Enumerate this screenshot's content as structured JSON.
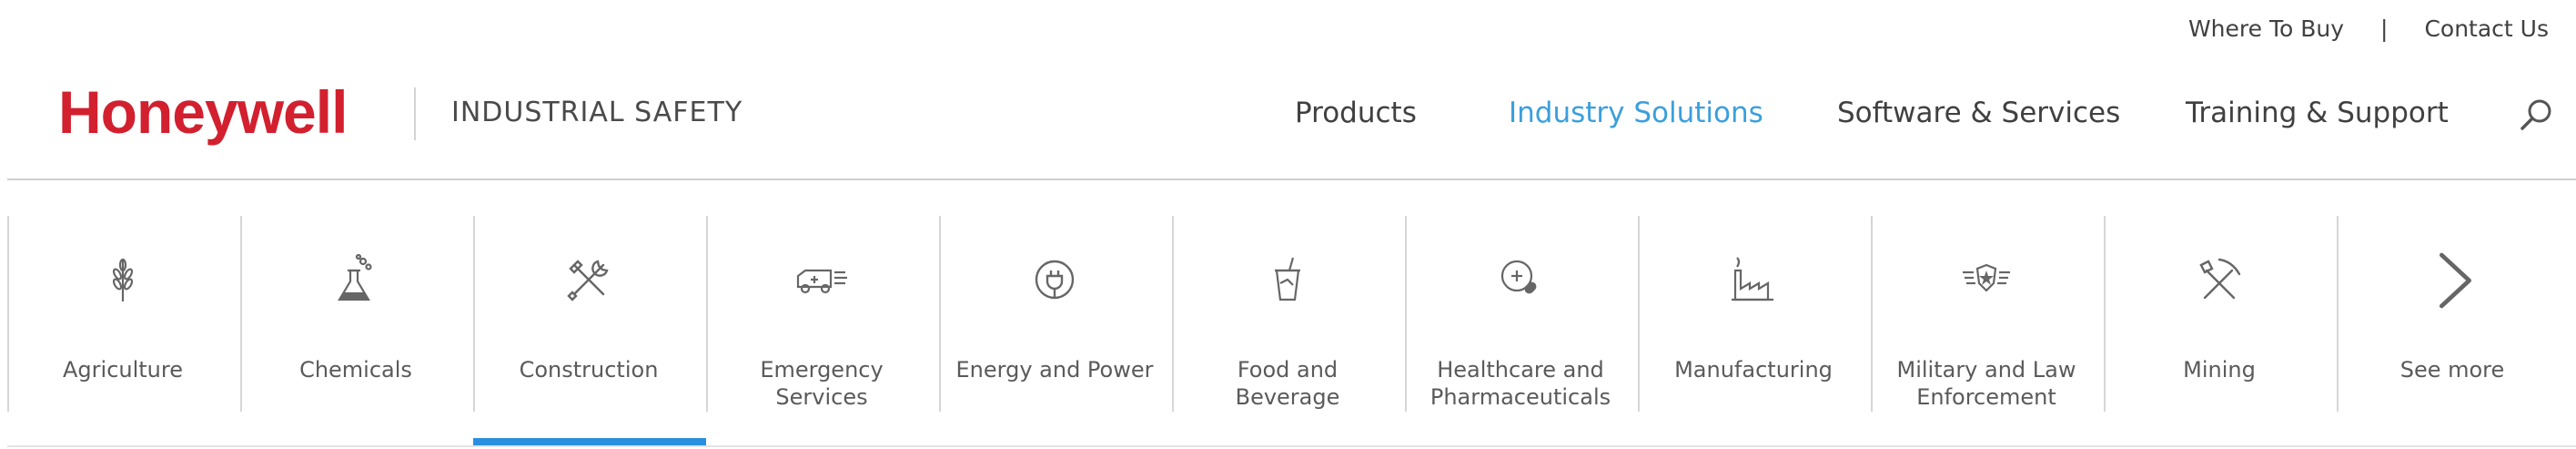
{
  "utility": {
    "where_to_buy": "Where To Buy",
    "separator": "|",
    "contact_us": "Contact Us"
  },
  "brand": {
    "logo_text": "Honeywell",
    "division": "INDUSTRIAL SAFETY",
    "logo_color": "#d2202f"
  },
  "nav": {
    "items": [
      {
        "label": "Products",
        "active": false
      },
      {
        "label": "Industry Solutions",
        "active": true
      },
      {
        "label": "Software & Services",
        "active": false
      },
      {
        "label": "Training & Support",
        "active": false
      }
    ],
    "active_color": "#3a9fdd",
    "search_icon": "search-icon"
  },
  "industries": {
    "selected": "Construction",
    "accent_color": "#2b8fe0",
    "items": [
      {
        "label": "Agriculture",
        "icon": "wheat-icon"
      },
      {
        "label": "Chemicals",
        "icon": "flask-icon"
      },
      {
        "label": "Construction",
        "icon": "tools-icon"
      },
      {
        "label": "Emergency\nServices",
        "icon": "ambulance-icon"
      },
      {
        "label": "Energy and Power",
        "icon": "power-plug-icon"
      },
      {
        "label": "Food and\nBeverage",
        "icon": "drink-cup-icon"
      },
      {
        "label": "Healthcare and\nPharmaceuticals",
        "icon": "medical-icon"
      },
      {
        "label": "Manufacturing",
        "icon": "factory-icon"
      },
      {
        "label": "Military and Law\nEnforcement",
        "icon": "badge-icon"
      },
      {
        "label": "Mining",
        "icon": "pickaxe-icon"
      },
      {
        "label": "See more",
        "icon": "chevron-right-icon"
      }
    ]
  }
}
